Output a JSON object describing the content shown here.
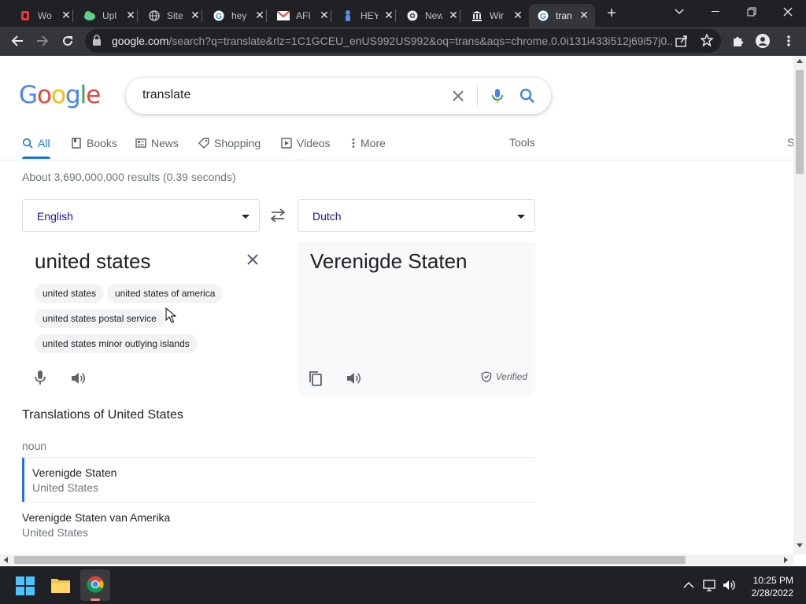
{
  "browser": {
    "tabs": [
      {
        "label": "Wo",
        "icon": "red-app-icon",
        "active": false
      },
      {
        "label": "Upl",
        "icon": "cloud-icon",
        "active": false
      },
      {
        "label": "Site",
        "icon": "globe-icon",
        "active": false
      },
      {
        "label": "hey",
        "icon": "google-g-icon",
        "active": false
      },
      {
        "label": "AFI",
        "icon": "gmail-icon",
        "active": false
      },
      {
        "label": "HEY",
        "icon": "person-icon",
        "active": false
      },
      {
        "label": "New",
        "icon": "chrome-icon",
        "active": false
      },
      {
        "label": "Wir",
        "icon": "museum-icon",
        "active": false
      },
      {
        "label": "tran",
        "icon": "google-g-icon",
        "active": true
      }
    ],
    "url_domain": "google.com",
    "url_rest": "/search?q=translate&rlz=1C1GCEU_enUS992US992&oq=trans&aqs=chrome.0.0i131i433i512j69i57j0..."
  },
  "search": {
    "query": "translate",
    "logo_letters": [
      "G",
      "o",
      "o",
      "g",
      "l",
      "e"
    ],
    "logo_colors": [
      "#4285F4",
      "#EA4335",
      "#FBBC05",
      "#4285F4",
      "#34A853",
      "#EA4335"
    ]
  },
  "nav": {
    "tabs": [
      {
        "label": "All",
        "icon": "search-icon",
        "selected": true
      },
      {
        "label": "Books",
        "icon": "book-icon",
        "selected": false
      },
      {
        "label": "News",
        "icon": "news-icon",
        "selected": false
      },
      {
        "label": "Shopping",
        "icon": "tag-icon",
        "selected": false
      },
      {
        "label": "Videos",
        "icon": "play-icon",
        "selected": false
      },
      {
        "label": "More",
        "icon": "dots-vertical-icon",
        "selected": false
      }
    ],
    "tools": "Tools",
    "s_cut": "S"
  },
  "results_stats": "About 3,690,000,000 results (0.39 seconds)",
  "translate": {
    "source_lang": "English",
    "target_lang": "Dutch",
    "source_text": "united states",
    "suggestions": [
      "united states",
      "united states of america",
      "united states postal service",
      "united states minor outlying islands"
    ],
    "target_text": "Verenigde Staten",
    "verified": "Verified"
  },
  "translations": {
    "heading": "Translations of United States",
    "pos": "noun",
    "entries": [
      {
        "main": "Verenigde Staten",
        "sub": "United States"
      },
      {
        "main": "Verenigde Staten van Amerika",
        "sub": "United States"
      }
    ]
  },
  "taskbar": {
    "time": "10:25 PM",
    "date": "2/28/2022"
  },
  "colors": {
    "accent": "#1a73e8",
    "link": "#1a0dab",
    "chrome_dark": "#202124"
  }
}
